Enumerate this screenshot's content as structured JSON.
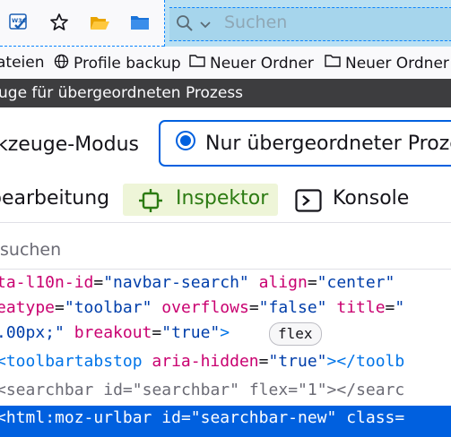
{
  "toolbar": {
    "buttons": [
      "w3c-validator-icon",
      "star-icon",
      "folder-open-icon",
      "folder-icon"
    ],
    "search": {
      "placeholder": "Suchen"
    }
  },
  "bookmarks": [
    {
      "label": "ateien",
      "icon": ""
    },
    {
      "label": "Profile backup",
      "icon": "globe-icon"
    },
    {
      "label": "Neuer Ordner",
      "icon": "folder-icon"
    },
    {
      "label": "Neuer Ordner",
      "icon": "folder-icon"
    }
  ],
  "process_bar": {
    "text": "uge für übergeordneten Prozess"
  },
  "mode": {
    "label": "kzeuge-Modus",
    "option": "Nur übergeordneter Proze"
  },
  "tabs": {
    "editor": "bearbeitung",
    "inspector": "Inspektor",
    "console": "Konsole"
  },
  "markup": {
    "search_text": "suchen",
    "lines": {
      "l1": {
        "a1": "ta-l10n-id",
        "v1": "\"navbar-search\"",
        "a2": "align",
        "v2": "\"center\""
      },
      "l2": {
        "a1": "eatype",
        "v1": "\"toolbar\"",
        "a2": "overflows",
        "v2": "\"false\"",
        "a3": "title",
        "v3": "\""
      },
      "l3": {
        "v0": ".00px;\"",
        "a1": "breakout",
        "v1": "\"true\"",
        "badge": "flex"
      },
      "l4": {
        "tag": "toolbartabstop",
        "a1": "aria-hidden",
        "v1": "\"true\"",
        "close": "</toolb"
      },
      "l5": {
        "tag": "searchbar",
        "a1": "id",
        "v1": "\"searchbar\"",
        "a2": "flex",
        "v2": "\"1\"",
        "close": "</searc"
      },
      "l6": {
        "tag": "html:moz-urlbar",
        "a1": "id",
        "v1": "\"searchbar-new\"",
        "a2": "class"
      }
    }
  },
  "colors": {
    "accent": "#0060df",
    "inspector_green": "#2c7b12",
    "selection": "#0060df",
    "attr": "#c90070",
    "value": "#003eaa"
  }
}
